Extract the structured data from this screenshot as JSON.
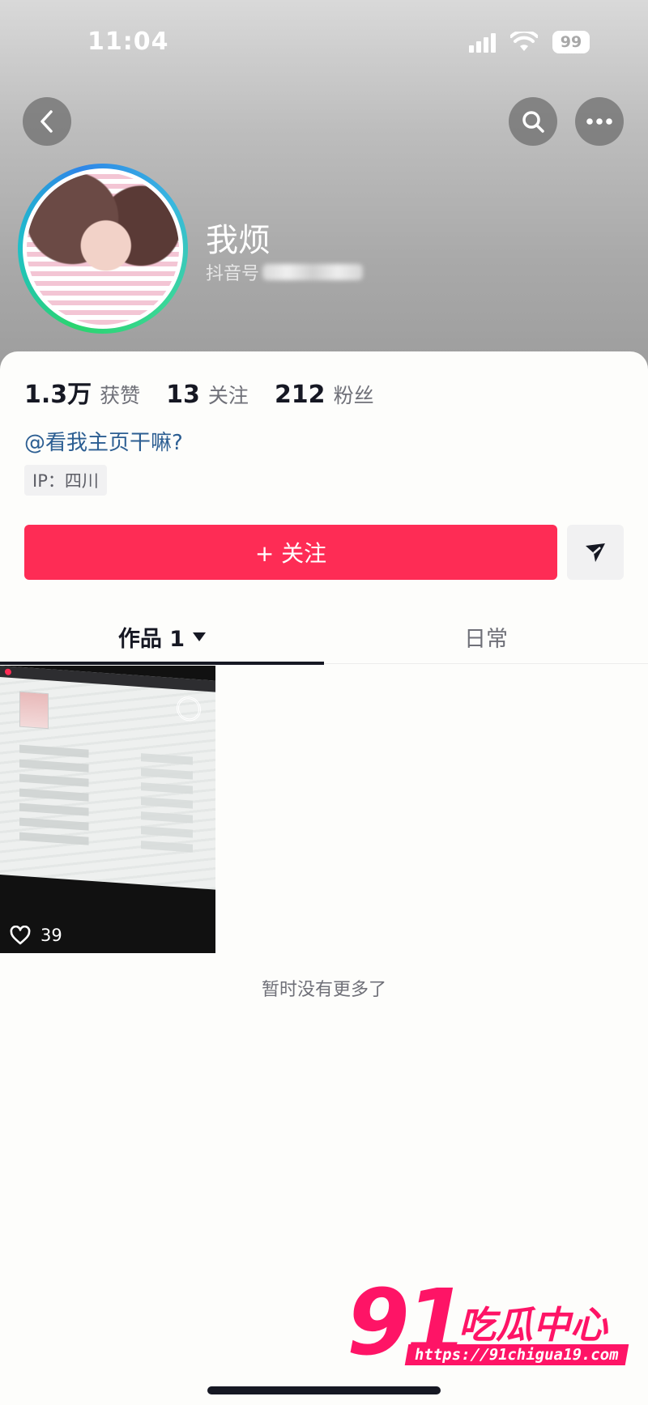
{
  "status_bar": {
    "time": "11:04",
    "battery": "99"
  },
  "nav": {
    "back_icon": "chevron-left-icon",
    "search_icon": "search-icon",
    "more_icon": "more-horizontal-icon"
  },
  "profile": {
    "name": "我烦",
    "douyin_id_label": "抖音号"
  },
  "stats": [
    {
      "value": "1.3万",
      "label": "获赞"
    },
    {
      "value": "13",
      "label": "关注"
    },
    {
      "value": "212",
      "label": "粉丝"
    }
  ],
  "bio": {
    "mention": "@看我主页干嘛?",
    "ip": "IP：四川"
  },
  "actions": {
    "follow_label": "+ 关注",
    "send_icon": "send-icon"
  },
  "tabs": [
    {
      "label": "作品 1",
      "active": true
    },
    {
      "label": "日常",
      "active": false
    }
  ],
  "videos": [
    {
      "likes": "39"
    }
  ],
  "feed_end_text": "暂时没有更多了",
  "watermark": {
    "number": "91",
    "name": "吃瓜中心",
    "url": "https://91chigua19.com"
  },
  "colors": {
    "accent": "#fe2c55",
    "mention": "#2c5e92",
    "watermark": "#fe1466"
  }
}
